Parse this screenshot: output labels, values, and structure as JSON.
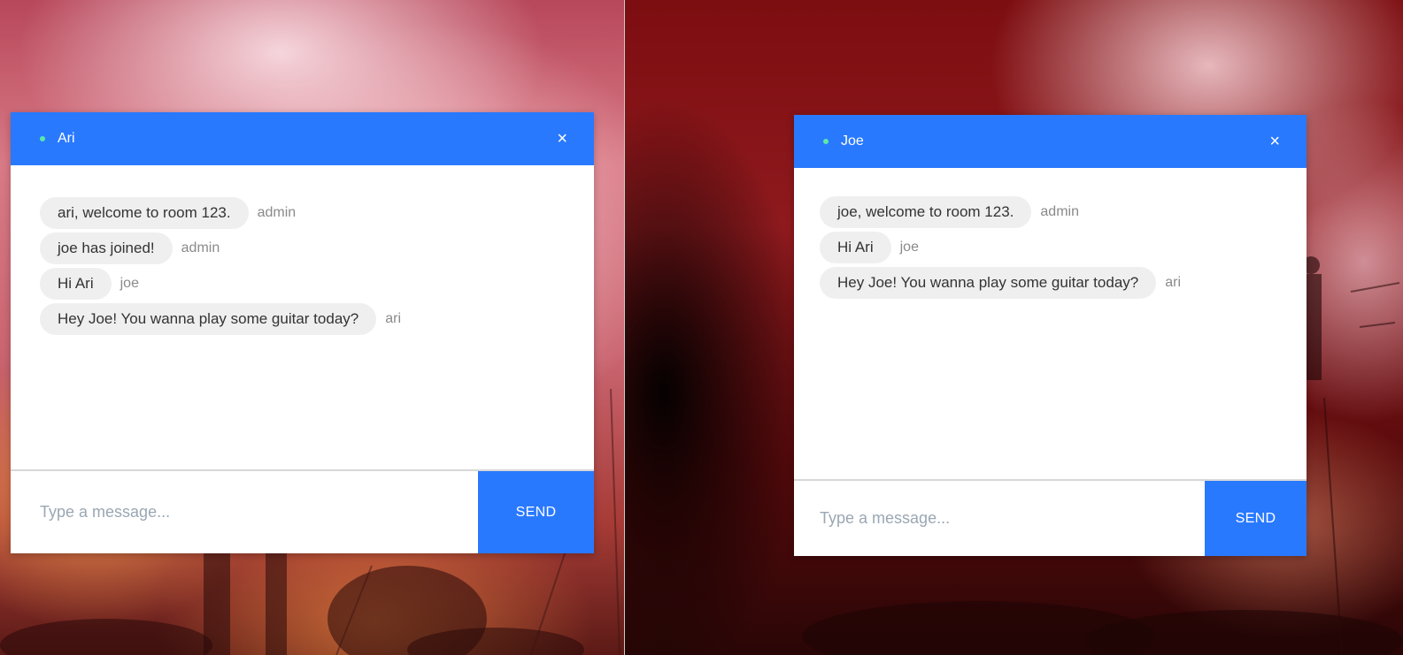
{
  "windows": [
    {
      "user": "Ari",
      "close_glyph": "×",
      "messages": [
        {
          "text": "ari, welcome to room 123.",
          "sender": "admin"
        },
        {
          "text": "joe has joined!",
          "sender": "admin"
        },
        {
          "text": "Hi Ari",
          "sender": "joe"
        },
        {
          "text": "Hey Joe! You wanna play some guitar today?",
          "sender": "ari"
        }
      ],
      "input_placeholder": "Type a message...",
      "send_label": "SEND"
    },
    {
      "user": "Joe",
      "close_glyph": "×",
      "messages": [
        {
          "text": "joe, welcome to room 123.",
          "sender": "admin"
        },
        {
          "text": "Hi Ari",
          "sender": "joe"
        },
        {
          "text": "Hey Joe! You wanna play some guitar today?",
          "sender": "ari"
        }
      ],
      "input_placeholder": "Type a message...",
      "send_label": "SEND"
    }
  ],
  "colors": {
    "header_blue": "#2979ff",
    "online_green": "#5be8a8",
    "bubble_gray": "#efefef"
  }
}
